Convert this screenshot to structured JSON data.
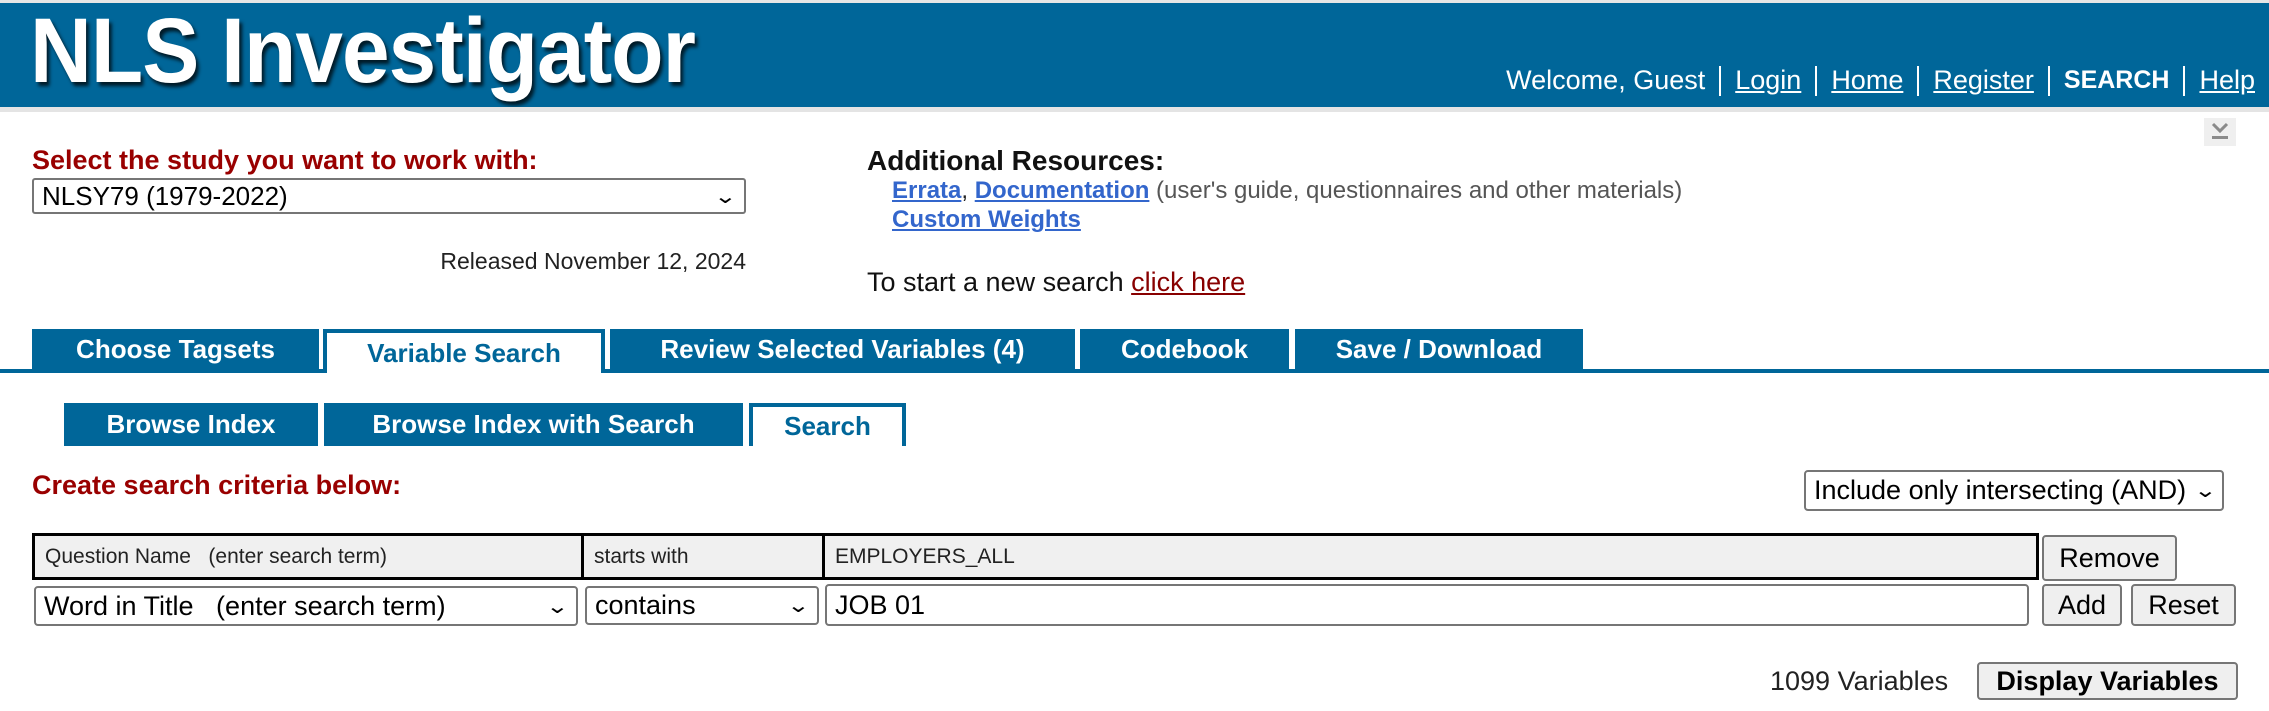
{
  "header": {
    "logo": "NLS Investigator",
    "welcome": "Welcome, Guest",
    "nav": [
      {
        "label": "Login",
        "link": true
      },
      {
        "label": "Home",
        "link": true
      },
      {
        "label": "Register",
        "link": true
      },
      {
        "label": "SEARCH",
        "link": false
      },
      {
        "label": "Help",
        "link": true
      }
    ],
    "collapse_icon": "collapse-chevron-icon"
  },
  "study": {
    "label": "Select the study you want to work with:",
    "selected": "NLSY79 (1979-2022)",
    "released": "Released November 12, 2024"
  },
  "resources": {
    "title": "Additional Resources:",
    "errata": "Errata",
    "comma": ", ",
    "documentation": "Documentation",
    "documentation_note": " (user's guide, questionnaires and other materials)",
    "custom_weights": "Custom Weights",
    "new_search_text": "To start a new search ",
    "new_search_link": "click here"
  },
  "main_tabs": [
    {
      "label": "Choose Tagsets",
      "active": false
    },
    {
      "label": "Variable Search",
      "active": true
    },
    {
      "label": "Review Selected Variables (4)",
      "active": false
    },
    {
      "label": "Codebook",
      "active": false
    },
    {
      "label": "Save / Download",
      "active": false
    }
  ],
  "sub_tabs": [
    {
      "label": "Browse Index",
      "active": false
    },
    {
      "label": "Browse Index with Search",
      "active": false
    },
    {
      "label": "Search",
      "active": true
    }
  ],
  "criteria": {
    "title": "Create search criteria below:",
    "combine_mode": "Include only intersecting (AND)",
    "existing": {
      "field": "Question Name   (enter search term)",
      "operator": "starts with",
      "value": "EMPLOYERS_ALL",
      "remove_label": "Remove"
    },
    "new": {
      "field": "Word in Title   (enter search term)",
      "operator": "contains",
      "value": "JOB 01",
      "add_label": "Add",
      "reset_label": "Reset"
    }
  },
  "results": {
    "count_text": "1099 Variables",
    "display_label": "Display Variables"
  },
  "colors": {
    "brand_blue": "#006699",
    "heading_red": "#990000",
    "link_blue": "#3366cc",
    "link_darkred": "#880000"
  }
}
